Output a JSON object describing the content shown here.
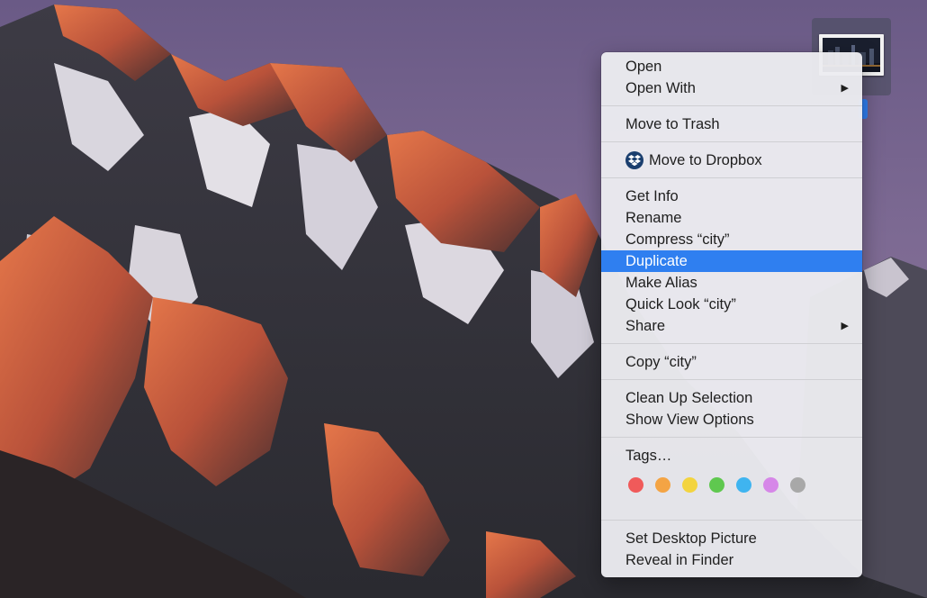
{
  "desktop": {
    "file_icon": {
      "icon": "image-file-icon"
    }
  },
  "context_menu": {
    "groups": [
      {
        "items": [
          {
            "label": "Open",
            "submenu": false
          },
          {
            "label": "Open With",
            "submenu": true
          }
        ]
      },
      {
        "items": [
          {
            "label": "Move to Trash",
            "submenu": false
          }
        ]
      },
      {
        "items": [
          {
            "label": "Move to Dropbox",
            "submenu": false,
            "icon": "dropbox-icon"
          }
        ]
      },
      {
        "items": [
          {
            "label": "Get Info",
            "submenu": false
          },
          {
            "label": "Rename",
            "submenu": false
          },
          {
            "label": "Compress “city”",
            "submenu": false
          },
          {
            "label": "Duplicate",
            "submenu": false,
            "selected": true
          },
          {
            "label": "Make Alias",
            "submenu": false
          },
          {
            "label": "Quick Look “city”",
            "submenu": false
          },
          {
            "label": "Share",
            "submenu": true
          }
        ]
      },
      {
        "items": [
          {
            "label": "Copy “city”",
            "submenu": false
          }
        ]
      },
      {
        "items": [
          {
            "label": "Clean Up Selection",
            "submenu": false
          },
          {
            "label": "Show View Options",
            "submenu": false
          }
        ]
      },
      {
        "items": [
          {
            "label": "Tags…",
            "submenu": false
          }
        ],
        "tags": [
          {
            "name": "red",
            "color": "#f05a5a"
          },
          {
            "name": "orange",
            "color": "#f4a444"
          },
          {
            "name": "yellow",
            "color": "#f3d43f"
          },
          {
            "name": "green",
            "color": "#5fc84f"
          },
          {
            "name": "blue",
            "color": "#3fb4f0"
          },
          {
            "name": "purple",
            "color": "#d687e8"
          },
          {
            "name": "gray",
            "color": "#a8a8a8"
          }
        ]
      },
      {
        "items": [
          {
            "label": "Set Desktop Picture",
            "submenu": false
          },
          {
            "label": "Reveal in Finder",
            "submenu": false
          }
        ]
      }
    ],
    "submenu_arrow_icon": "▶",
    "selection_color": "#2f7ff0"
  }
}
